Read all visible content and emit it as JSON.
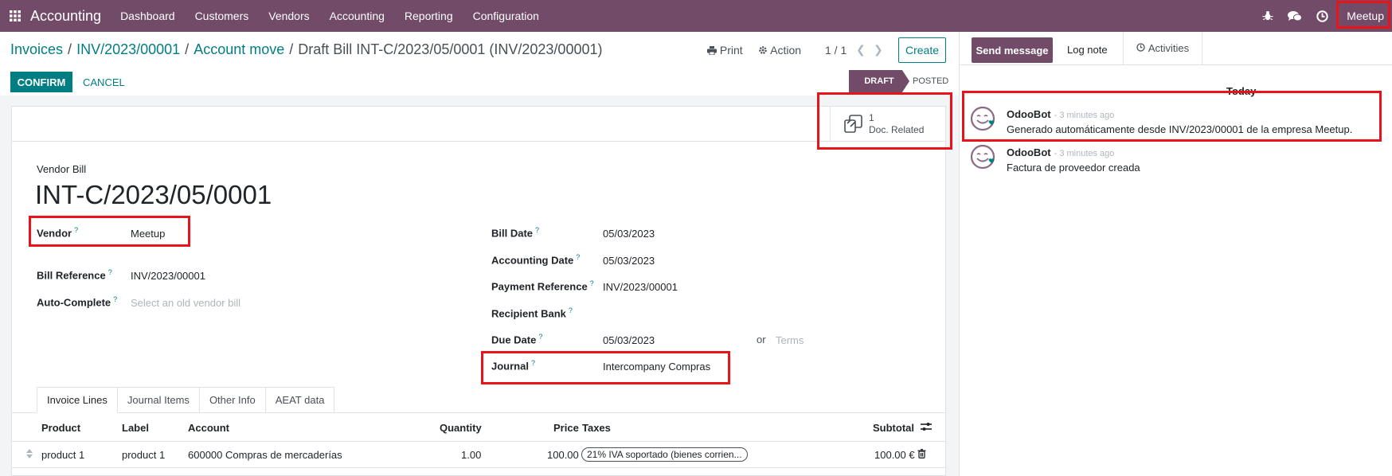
{
  "navbar": {
    "app_name": "Accounting",
    "menus": [
      "Dashboard",
      "Customers",
      "Vendors",
      "Accounting",
      "Reporting",
      "Configuration"
    ],
    "company": "Meetup",
    "icons": [
      "apps-icon",
      "bug-icon",
      "chat-icon",
      "clock-icon"
    ],
    "color": "#714b67"
  },
  "breadcrumb": {
    "items": [
      "Invoices",
      "INV/2023/00001",
      "Account move"
    ],
    "current": "Draft Bill INT-C/2023/05/0001 (INV/2023/00001)"
  },
  "control_panel": {
    "print": "Print",
    "action": "Action",
    "pager": "1 / 1",
    "create": "Create"
  },
  "status": {
    "confirm": "CONFIRM",
    "cancel": "CANCEL",
    "steps": [
      "DRAFT",
      "POSTED"
    ],
    "active": "DRAFT"
  },
  "smart_button": {
    "count": "1",
    "label": "Doc. Related"
  },
  "form": {
    "type_label": "Vendor Bill",
    "name": "INT-C/2023/05/0001",
    "vendor_label": "Vendor",
    "vendor": "Meetup",
    "bill_reference_label": "Bill Reference",
    "bill_reference": "INV/2023/00001",
    "auto_complete_label": "Auto-Complete",
    "auto_complete_placeholder": "Select an old vendor bill",
    "bill_date_label": "Bill Date",
    "bill_date": "05/03/2023",
    "accounting_date_label": "Accounting Date",
    "accounting_date": "05/03/2023",
    "payment_reference_label": "Payment Reference",
    "payment_reference": "INV/2023/00001",
    "recipient_bank_label": "Recipient Bank",
    "due_date_label": "Due Date",
    "due_date": "05/03/2023",
    "or_text": "or",
    "terms_placeholder": "Terms",
    "journal_label": "Journal",
    "journal": "Intercompany Compras",
    "help_mark": "?"
  },
  "tabs": [
    "Invoice Lines",
    "Journal Items",
    "Other Info",
    "AEAT data"
  ],
  "lines": {
    "headers": [
      "Product",
      "Label",
      "Account",
      "Quantity",
      "Price",
      "Taxes",
      "Subtotal"
    ],
    "rows": [
      {
        "product": "product 1",
        "label": "product 1",
        "account": "600000 Compras de mercaderías",
        "quantity": "1.00",
        "price": "100.00",
        "taxes": "21% IVA soportado (bienes corrien...",
        "subtotal": "100.00 €"
      }
    ]
  },
  "chatter": {
    "send_message": "Send message",
    "log_note": "Log note",
    "activities": "Activities",
    "today": "Today",
    "messages": [
      {
        "author": "OdooBot",
        "time": "- 3 minutes ago",
        "body": "Generado automáticamente desde INV/2023/00001 de la empresa Meetup."
      },
      {
        "author": "OdooBot",
        "time": "- 3 minutes ago",
        "body": "Factura de proveedor creada"
      }
    ]
  }
}
